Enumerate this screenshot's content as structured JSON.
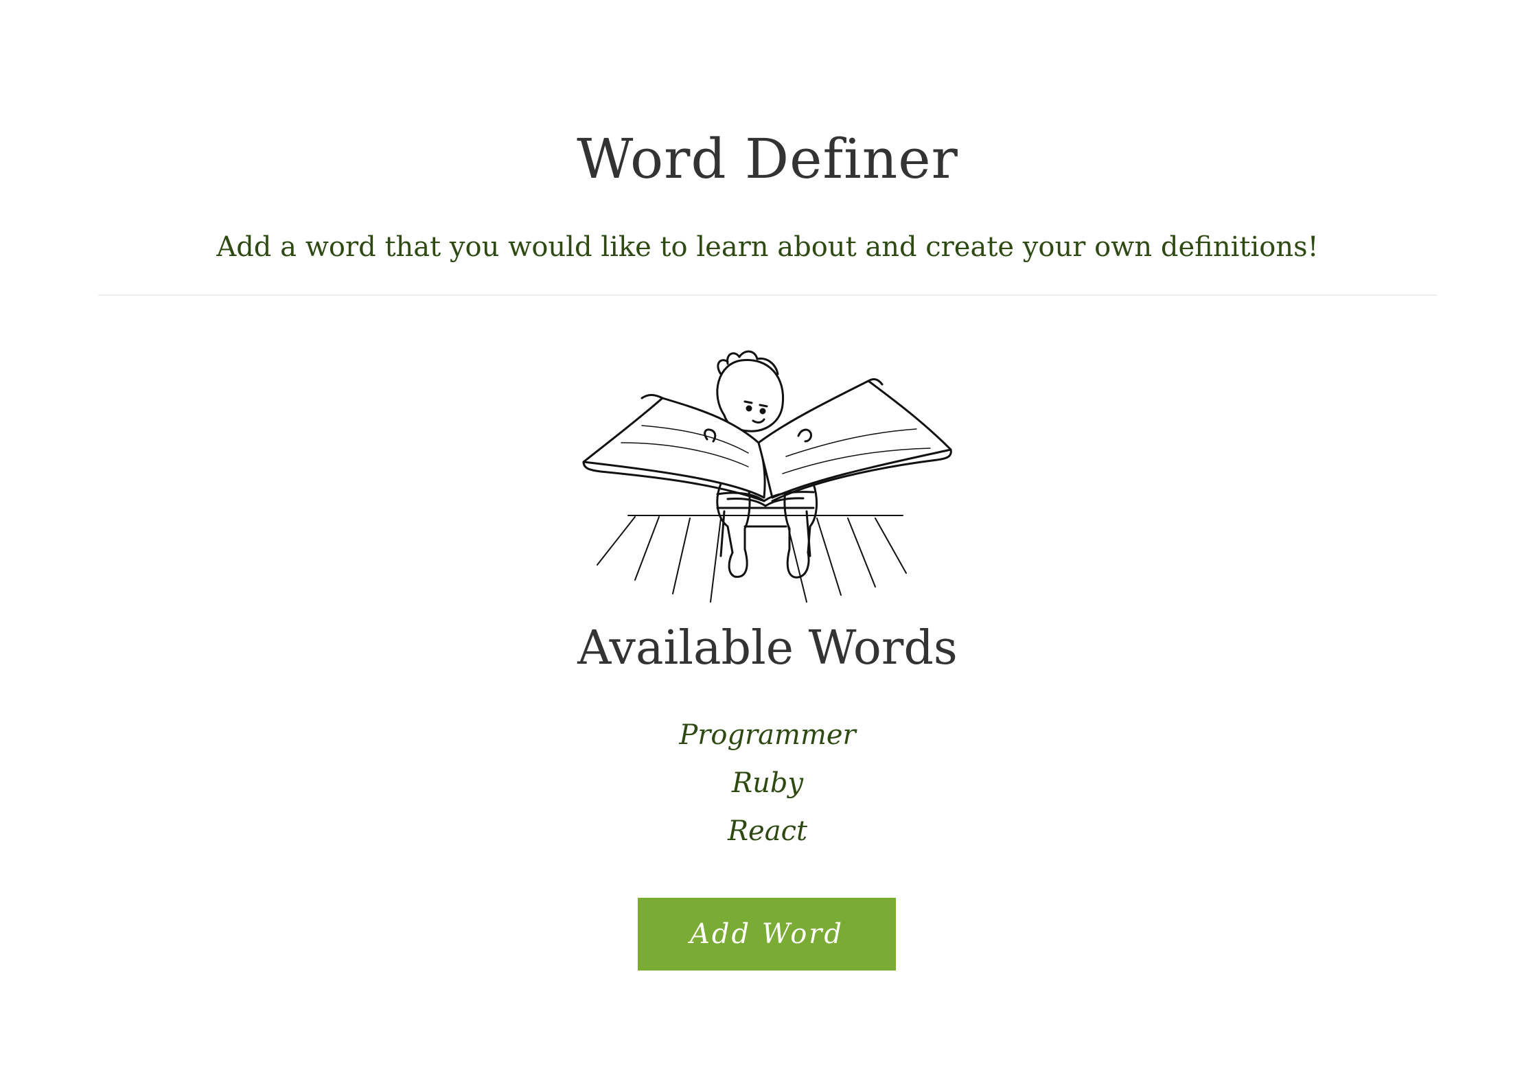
{
  "header": {
    "title": "Word Definer",
    "subtitle": "Add a word that you would like to learn about and create your own definitions!"
  },
  "main": {
    "illustration_icon": "child-reading-big-book-illustration",
    "section_title": "Available Words",
    "words": [
      {
        "label": "Programmer"
      },
      {
        "label": "Ruby"
      },
      {
        "label": "React"
      }
    ],
    "add_button_label": "Add Word"
  },
  "colors": {
    "heading_text": "#333333",
    "green_text": "#2e4a12",
    "button_background": "#7aab35",
    "button_text": "#ffffff",
    "divider": "#eeeeee"
  }
}
